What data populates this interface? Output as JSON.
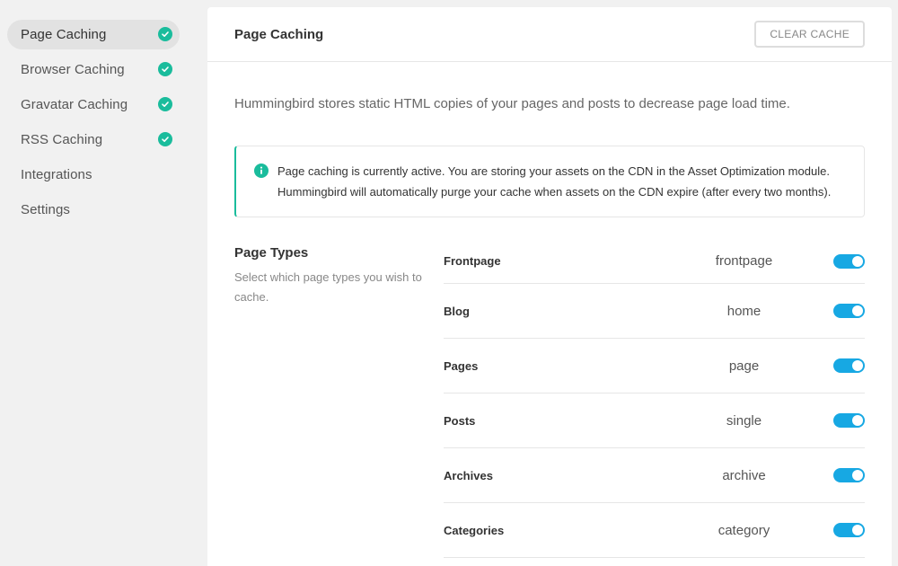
{
  "sidebar": {
    "items": [
      {
        "label": "Page Caching",
        "checked": true,
        "active": true
      },
      {
        "label": "Browser Caching",
        "checked": true
      },
      {
        "label": "Gravatar Caching",
        "checked": true
      },
      {
        "label": "RSS Caching",
        "checked": true
      },
      {
        "label": "Integrations",
        "checked": false
      },
      {
        "label": "Settings",
        "checked": false
      }
    ]
  },
  "header": {
    "title": "Page Caching",
    "clear_cache_label": "CLEAR CACHE"
  },
  "main": {
    "description": "Hummingbird stores static HTML copies of your pages and posts to decrease page load time.",
    "notice": {
      "line1": "Page caching is currently active. You are storing your assets on the CDN in the Asset Optimization module.",
      "line2": "Hummingbird will automatically purge your cache when assets on the CDN expire (after every two months)."
    },
    "page_types": {
      "title": "Page Types",
      "description": "Select which page types you wish to cache.",
      "rows": [
        {
          "label": "Frontpage",
          "value": "frontpage",
          "enabled": true
        },
        {
          "label": "Blog",
          "value": "home",
          "enabled": true
        },
        {
          "label": "Pages",
          "value": "page",
          "enabled": true
        },
        {
          "label": "Posts",
          "value": "single",
          "enabled": true
        },
        {
          "label": "Archives",
          "value": "archive",
          "enabled": true
        },
        {
          "label": "Categories",
          "value": "category",
          "enabled": true
        }
      ]
    }
  },
  "colors": {
    "accent_green": "#1abc9c",
    "toggle_blue": "#17a8e3"
  },
  "icons": {
    "nav_check": "check-circle-icon",
    "notice": "info-icon"
  }
}
